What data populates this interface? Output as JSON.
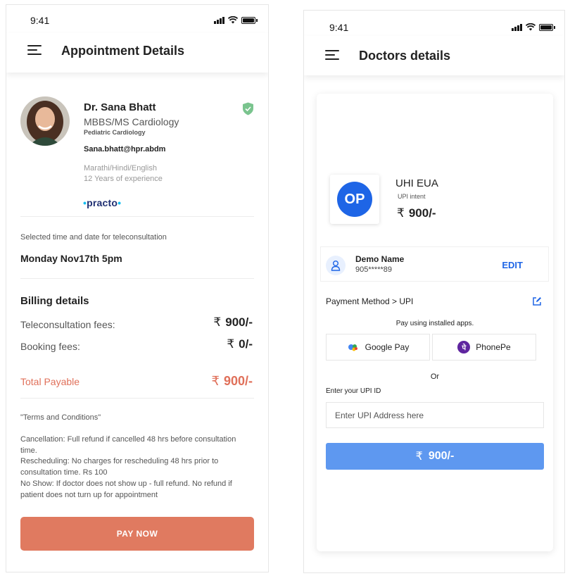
{
  "left_screen": {
    "status_time": "9:41",
    "title": "Appointment Details",
    "doctor": {
      "name": "Dr. Sana Bhatt",
      "degree": "MBBS/MS Cardiology",
      "specialty": "Pediatric Cardiology",
      "email": "Sana.bhatt@hpr.abdm",
      "languages": "Marathi/Hindi/English",
      "experience": "12 Years of experience",
      "provider": "practo"
    },
    "selected_caption": "Selected time and date for teleconsultation",
    "selected_value": "Monday Nov17th 5pm",
    "billing_title": "Billing details",
    "billing_items": [
      {
        "label": "Teleconsultation fees:",
        "currency": "₹",
        "amount": "900/-"
      },
      {
        "label": "Booking fees:",
        "currency": "₹",
        "amount": "0/-"
      }
    ],
    "total_label": "Total Payable",
    "total_currency": "₹",
    "total_amount": "900/-",
    "terms_title": "\"Terms and Conditions\"",
    "terms": [
      "Cancellation: Full refund if cancelled 48 hrs before consultation time.",
      "Rescheduling: No charges for rescheduling 48 hrs prior to consultation time. Rs 100",
      "No Show:  If doctor does not show up - full refund. No refund if patient does not turn up for appointment"
    ],
    "pay_button": "PAY NOW"
  },
  "right_screen": {
    "status_time": "9:41",
    "title": "Doctors details",
    "provider_logo_text": "OP",
    "eua_title": "UHI EUA",
    "eua_subtitle": "UPI intent",
    "eua_currency": "₹",
    "eua_amount": "900/-",
    "user_name": "Demo Name",
    "user_phone": "905*****89",
    "edit_label": "EDIT",
    "payment_method": "Payment Method > UPI",
    "pay_using": "Pay using installed apps.",
    "apps": [
      "Google Pay",
      "PhonePe"
    ],
    "or_text": "Or",
    "upi_caption": "Enter your UPI ID",
    "upi_placeholder": "Enter UPI Address here",
    "pay_currency": "₹",
    "pay_amount": "900/-"
  },
  "colors": {
    "accent_orange": "#e07a60",
    "accent_blue": "#1e65e6",
    "button_blue": "#5e98f0",
    "verified_green": "#7ac48e"
  }
}
